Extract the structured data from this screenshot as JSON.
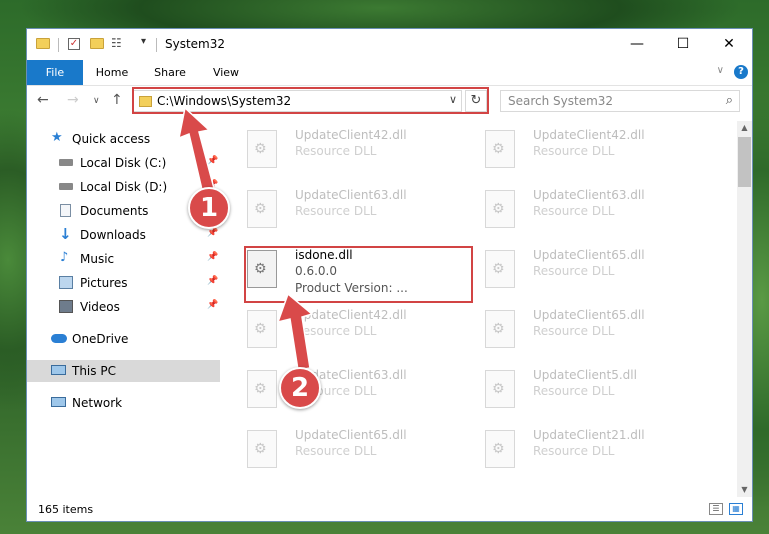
{
  "window": {
    "title": "System32"
  },
  "titlebar": {
    "minimize": "—",
    "maximize": "☐",
    "close": "✕"
  },
  "ribbon": {
    "tabs": [
      "File",
      "Home",
      "Share",
      "View"
    ],
    "help": "?"
  },
  "nav": {
    "address": "C:\\Windows\\System32",
    "search_placeholder": "Search System32"
  },
  "sidebar": {
    "items": [
      {
        "label": "Quick access",
        "icon": "star-icon"
      },
      {
        "label": "Local Disk (C:)",
        "icon": "drive-icon",
        "pinned": true
      },
      {
        "label": "Local Disk (D:)",
        "icon": "drive-icon",
        "pinned": true
      },
      {
        "label": "Documents",
        "icon": "documents-icon",
        "pinned": true
      },
      {
        "label": "Downloads",
        "icon": "download-icon",
        "pinned": true
      },
      {
        "label": "Music",
        "icon": "music-icon",
        "pinned": true
      },
      {
        "label": "Pictures",
        "icon": "pictures-icon",
        "pinned": true
      },
      {
        "label": "Videos",
        "icon": "videos-icon",
        "pinned": true
      },
      {
        "label": "OneDrive",
        "icon": "cloud-icon"
      },
      {
        "label": "This PC",
        "icon": "computer-icon",
        "selected": true
      },
      {
        "label": "Network",
        "icon": "network-icon"
      }
    ]
  },
  "files": [
    {
      "name": "UpdateClient42.dll",
      "type": "Resource DLL"
    },
    {
      "name": "UpdateClient42.dll",
      "type": "Resource DLL"
    },
    {
      "name": "UpdateClient63.dll",
      "type": "Resource DLL"
    },
    {
      "name": "UpdateClient63.dll",
      "type": "Resource DLL"
    },
    {
      "name": "isdone.dll",
      "type": "0.6.0.0",
      "meta": "Product Version:    ..."
    },
    {
      "name": "UpdateClient65.dll",
      "type": "Resource DLL"
    },
    {
      "name": "UpdateClient42.dll",
      "type": "Resource DLL"
    },
    {
      "name": "UpdateClient65.dll",
      "type": "Resource DLL"
    },
    {
      "name": "UpdateClient63.dll",
      "type": "Resource DLL"
    },
    {
      "name": "UpdateClient5.dll",
      "type": "Resource DLL"
    },
    {
      "name": "UpdateClient65.dll",
      "type": "Resource DLL"
    },
    {
      "name": "UpdateClient21.dll",
      "type": "Resource DLL"
    }
  ],
  "status": {
    "items": "165 items"
  },
  "callouts": {
    "step1": "1",
    "step2": "2",
    "color": "#d94a4a"
  }
}
